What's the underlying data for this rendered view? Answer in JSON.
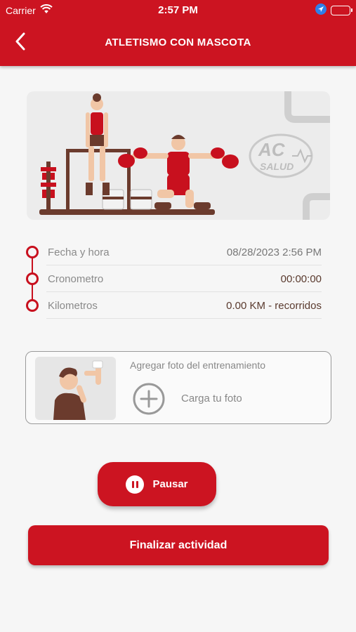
{
  "status_bar": {
    "carrier": "Carrier",
    "time": "2:57 PM"
  },
  "header": {
    "title": "ATLETISMO CON MASCOTA"
  },
  "hero": {
    "logo_text_top": "AC",
    "logo_text_bottom": "SALUD"
  },
  "info": {
    "rows": [
      {
        "label": "Fecha y hora",
        "value": "08/28/2023 2:56 PM"
      },
      {
        "label": "Cronometro",
        "value": "00:00:00"
      },
      {
        "label": "Kilometros",
        "value": "0.00 KM - recorridos"
      }
    ]
  },
  "photo": {
    "title": "Agregar foto del entrenamiento",
    "upload_label": "Carga tu foto"
  },
  "actions": {
    "pause_label": "Pausar",
    "finish_label": "Finalizar actividad"
  },
  "colors": {
    "brand_red": "#cc1421",
    "background": "#f6f6f6"
  }
}
